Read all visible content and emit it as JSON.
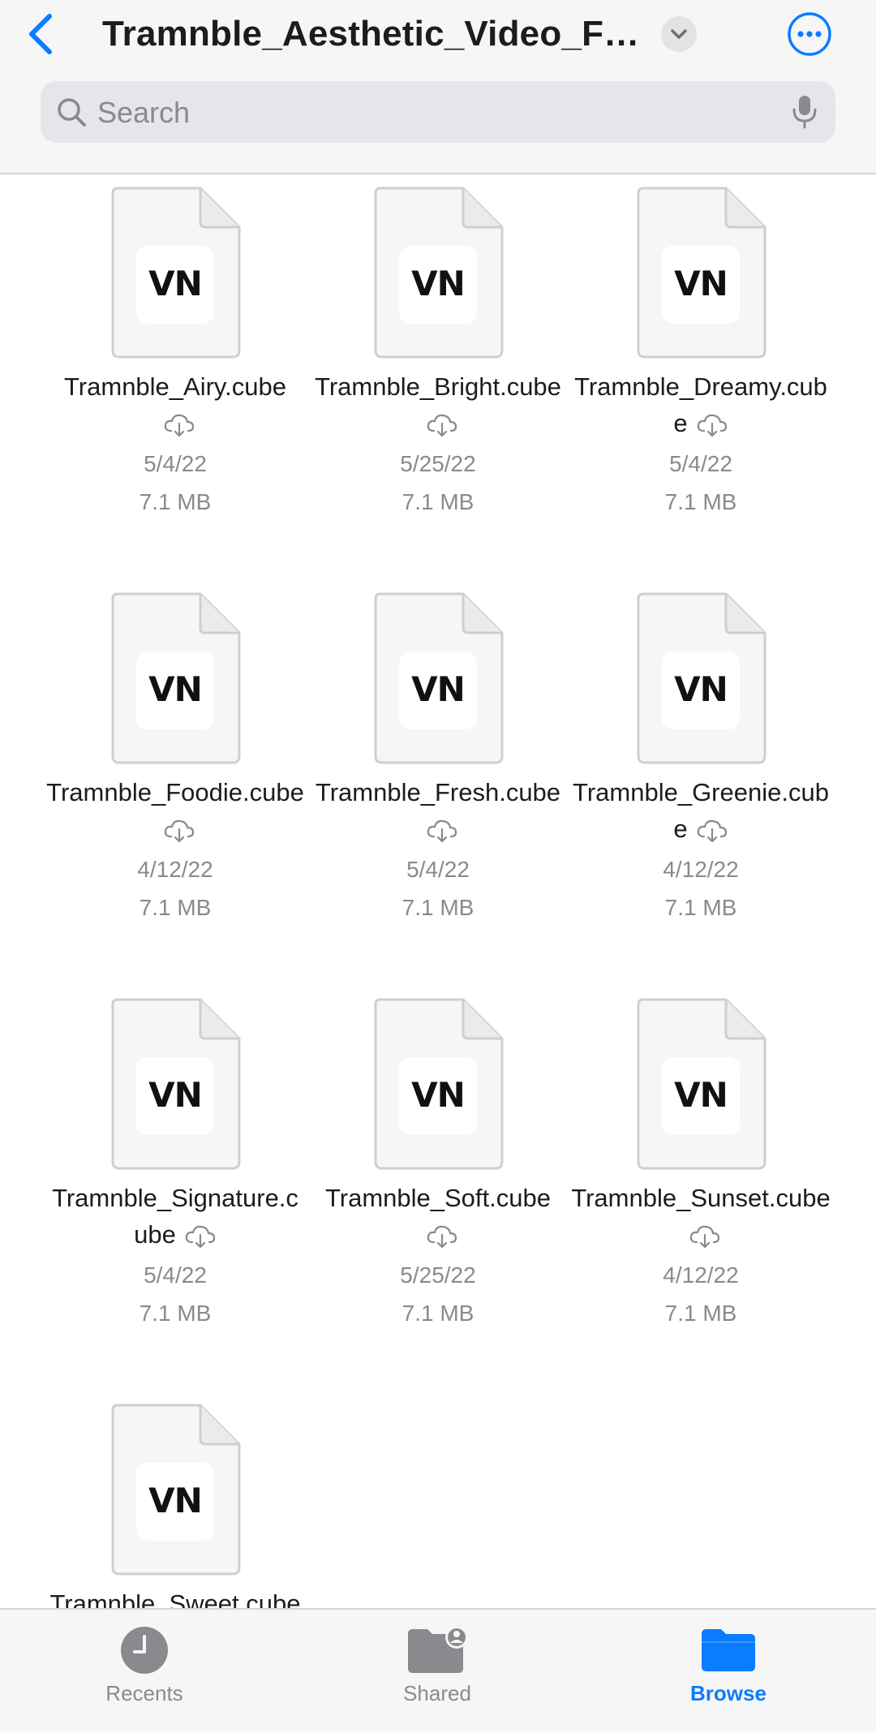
{
  "header": {
    "title": "Tramnble_Aesthetic_Video_Filters",
    "search_placeholder": "Search"
  },
  "colors": {
    "accent": "#0a7cff",
    "secondary_text": "#8a8a8e",
    "header_bg": "#f6f6f7"
  },
  "files": [
    {
      "name": "Tramnble_Airy.cube",
      "date": "5/4/22",
      "size": "7.1 MB",
      "badge": "VN"
    },
    {
      "name": "Tramnble_Bright.cube",
      "date": "5/25/22",
      "size": "7.1 MB",
      "badge": "VN"
    },
    {
      "name": "Tramnble_Dreamy.cube",
      "date": "5/4/22",
      "size": "7.1 MB",
      "badge": "VN"
    },
    {
      "name": "Tramnble_Foodie.cube",
      "date": "4/12/22",
      "size": "7.1 MB",
      "badge": "VN"
    },
    {
      "name": "Tramnble_Fresh.cube",
      "date": "5/4/22",
      "size": "7.1 MB",
      "badge": "VN"
    },
    {
      "name": "Tramnble_Greenie.cube",
      "date": "4/12/22",
      "size": "7.1 MB",
      "badge": "VN"
    },
    {
      "name": "Tramnble_Signature.cube",
      "date": "5/4/22",
      "size": "7.1 MB",
      "badge": "VN"
    },
    {
      "name": "Tramnble_Soft.cube",
      "date": "5/25/22",
      "size": "7.1 MB",
      "badge": "VN"
    },
    {
      "name": "Tramnble_Sunset.cube",
      "date": "4/12/22",
      "size": "7.1 MB",
      "badge": "VN"
    },
    {
      "name": "Tramnble_Sweet.cube",
      "date": "",
      "size": "",
      "badge": "VN"
    }
  ],
  "tabs": [
    {
      "label": "Recents",
      "icon": "clock-icon",
      "active": false
    },
    {
      "label": "Shared",
      "icon": "shared-folder-icon",
      "active": false
    },
    {
      "label": "Browse",
      "icon": "folder-icon",
      "active": true
    }
  ]
}
